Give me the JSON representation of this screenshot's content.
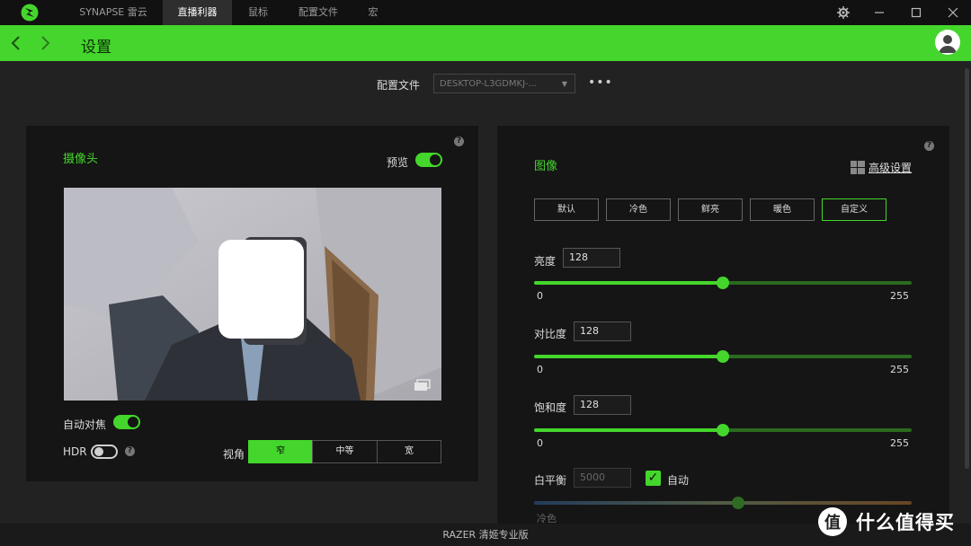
{
  "titlebar": {
    "tabs": [
      {
        "label": "SYNAPSE 雷云",
        "active": false
      },
      {
        "label": "直播利器",
        "active": true
      },
      {
        "label": "鼠标",
        "active": false
      },
      {
        "label": "配置文件",
        "active": false
      },
      {
        "label": "宏",
        "active": false
      }
    ],
    "icons": [
      "razer-logo-icon",
      "gear-icon",
      "minimize-icon",
      "maximize-icon",
      "close-icon"
    ]
  },
  "header": {
    "title": "设置",
    "accent_color": "#44d62c"
  },
  "profile": {
    "label": "配置文件",
    "selected": "DESKTOP-L3GDMKJ-..."
  },
  "camera_panel": {
    "title": "摄像头",
    "preview_label": "预览",
    "preview_on": true,
    "autofocus_label": "自动对焦",
    "autofocus_on": true,
    "hdr_label": "HDR",
    "hdr_on": false,
    "fov_label": "视角",
    "fov_options": [
      "窄",
      "中等",
      "宽"
    ],
    "fov_selected": "窄"
  },
  "image_panel": {
    "title": "图像",
    "advanced_link": "高级设置",
    "presets": [
      "默认",
      "冷色",
      "鲜亮",
      "暖色",
      "自定义"
    ],
    "preset_selected": "自定义",
    "sliders": [
      {
        "label": "亮度",
        "value": "128",
        "min": "0",
        "max": "255",
        "level": 0.5
      },
      {
        "label": "对比度",
        "value": "128",
        "min": "0",
        "max": "255",
        "level": 0.5
      },
      {
        "label": "饱和度",
        "value": "128",
        "min": "0",
        "max": "255",
        "level": 0.5
      }
    ],
    "white_balance": {
      "label": "白平衡",
      "value": "5000",
      "auto_label": "自动",
      "auto_checked": true,
      "min_label": "冷色",
      "level": 0.54
    }
  },
  "footer": {
    "text": "RAZER 清姬专业版"
  },
  "watermark": {
    "text": "什么值得买"
  }
}
